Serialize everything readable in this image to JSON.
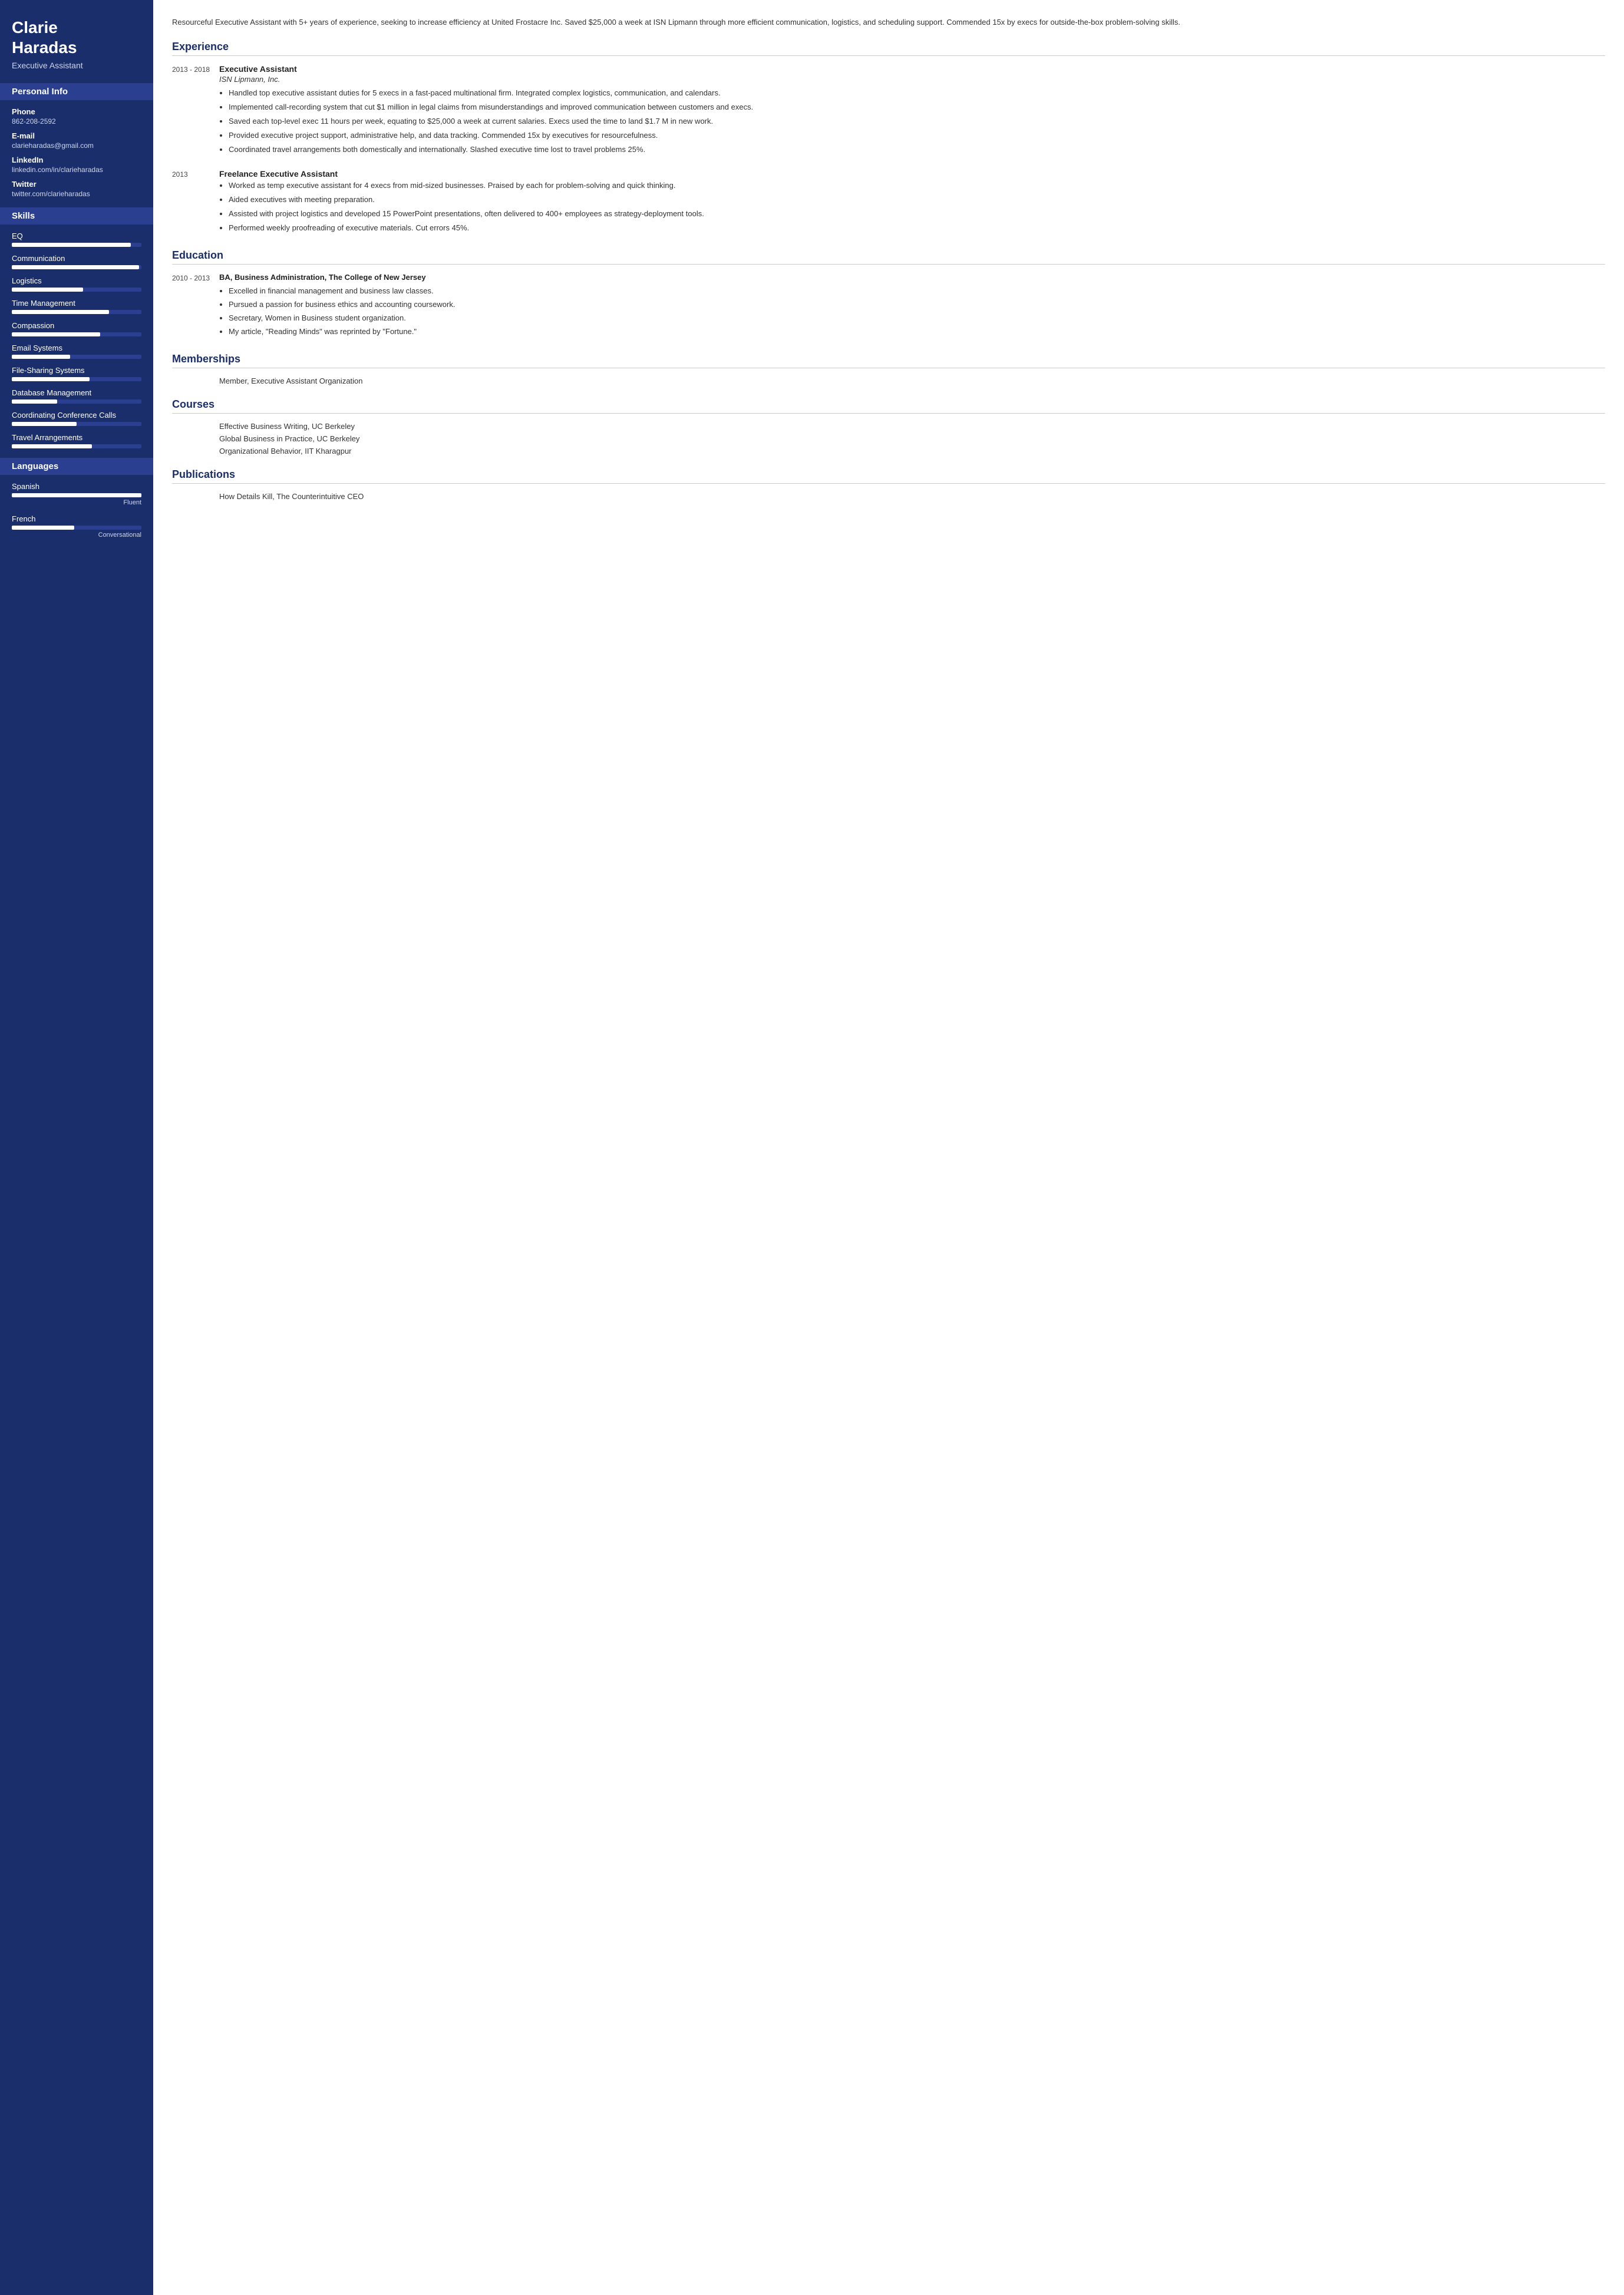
{
  "sidebar": {
    "name_line1": "Clarie",
    "name_line2": "Haradas",
    "title": "Executive Assistant",
    "sections": {
      "personal_info": "Personal Info",
      "skills": "Skills",
      "languages": "Languages"
    },
    "contact": {
      "phone_label": "Phone",
      "phone": "862-208-2592",
      "email_label": "E-mail",
      "email": "clarieharadas@gmail.com",
      "linkedin_label": "LinkedIn",
      "linkedin": "linkedin.com/in/clarieharadas",
      "twitter_label": "Twitter",
      "twitter": "twitter.com/clarieharadas"
    },
    "skills": [
      {
        "name": "EQ",
        "pct": 92
      },
      {
        "name": "Communication",
        "pct": 98
      },
      {
        "name": "Logistics",
        "pct": 55
      },
      {
        "name": "Time Management",
        "pct": 75
      },
      {
        "name": "Compassion",
        "pct": 68
      },
      {
        "name": "Email Systems",
        "pct": 45
      },
      {
        "name": "File-Sharing Systems",
        "pct": 60
      },
      {
        "name": "Database Management",
        "pct": 35
      },
      {
        "name": "Coordinating Conference Calls",
        "pct": 50
      },
      {
        "name": "Travel Arrangements",
        "pct": 62
      }
    ],
    "languages": [
      {
        "name": "Spanish",
        "pct": 100,
        "level": "Fluent"
      },
      {
        "name": "French",
        "pct": 48,
        "level": "Conversational"
      }
    ]
  },
  "main": {
    "summary": "Resourceful Executive Assistant with 5+ years of experience, seeking to increase efficiency at United Frostacre Inc. Saved $25,000 a week at ISN Lipmann through more efficient communication, logistics, and scheduling support. Commended 15x by execs for outside-the-box problem-solving skills.",
    "sections": {
      "experience": "Experience",
      "education": "Education",
      "memberships": "Memberships",
      "courses": "Courses",
      "publications": "Publications"
    },
    "experience": [
      {
        "date": "2013 - 2018",
        "title": "Executive Assistant",
        "company": "ISN Lipmann, Inc.",
        "bullets": [
          "Handled top executive assistant duties for 5 execs in a fast-paced multinational firm. Integrated complex logistics, communication, and calendars.",
          "Implemented call-recording system that cut $1 million in legal claims from misunderstandings and improved communication between customers and execs.",
          "Saved each top-level exec 11 hours per week, equating to $25,000 a week at current salaries. Execs used the time to land $1.7 M in new work.",
          "Provided executive project support, administrative help, and data tracking. Commended 15x by executives for resourcefulness.",
          "Coordinated travel arrangements both domestically and internationally. Slashed executive time lost to travel problems 25%."
        ]
      },
      {
        "date": "2013",
        "title": "Freelance Executive Assistant",
        "company": "",
        "bullets": [
          "Worked as temp executive assistant for 4 execs from mid-sized businesses. Praised by each for problem-solving and quick thinking.",
          "Aided executives with meeting preparation.",
          "Assisted with project logistics and developed 15 PowerPoint presentations, often delivered to 400+ employees as strategy-deployment tools.",
          "Performed weekly proofreading of executive materials. Cut errors 45%."
        ]
      }
    ],
    "education": [
      {
        "date": "2010 - 2013",
        "degree": "BA, Business Administration, The College of New Jersey",
        "bullets": [
          "Excelled in financial management and business law classes.",
          "Pursued a passion for business ethics and accounting coursework.",
          "Secretary, Women in Business student organization.",
          "My article, \"Reading Minds\" was reprinted by \"Fortune.\""
        ]
      }
    ],
    "memberships": [
      "Member, Executive Assistant Organization"
    ],
    "courses": [
      "Effective Business Writing, UC Berkeley",
      "Global Business in Practice, UC Berkeley",
      "Organizational Behavior, IIT Kharagpur"
    ],
    "publications": [
      "How Details Kill, The Counterintuitive CEO"
    ]
  }
}
